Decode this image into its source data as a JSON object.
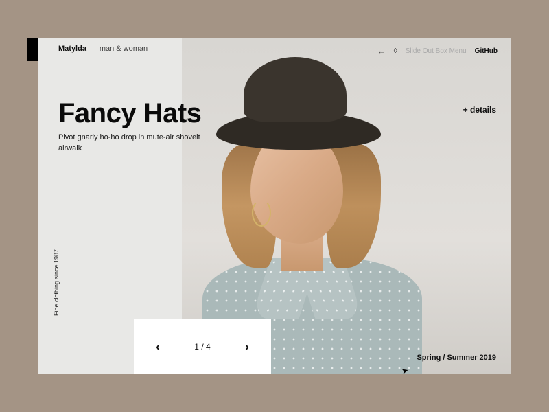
{
  "header": {
    "brand": "Matylda",
    "divider": "|",
    "category": "man & woman"
  },
  "nav": {
    "back_arrow": "←",
    "decoration": "◊",
    "muted": "Slide Out Box Menu",
    "strong": "GitHub"
  },
  "hero": {
    "title": "Fancy Hats",
    "subtitle": "Pivot gnarly ho-ho drop in mute-air shoveit airwalk"
  },
  "details": {
    "label": "+ details"
  },
  "pager": {
    "prev": "‹",
    "next": "›",
    "current": 1,
    "total": 4
  },
  "footer": {
    "vertical": "Fine clothing since 1987",
    "season": "Spring / Summer 2019"
  },
  "icons": {
    "cursor": "➤"
  }
}
